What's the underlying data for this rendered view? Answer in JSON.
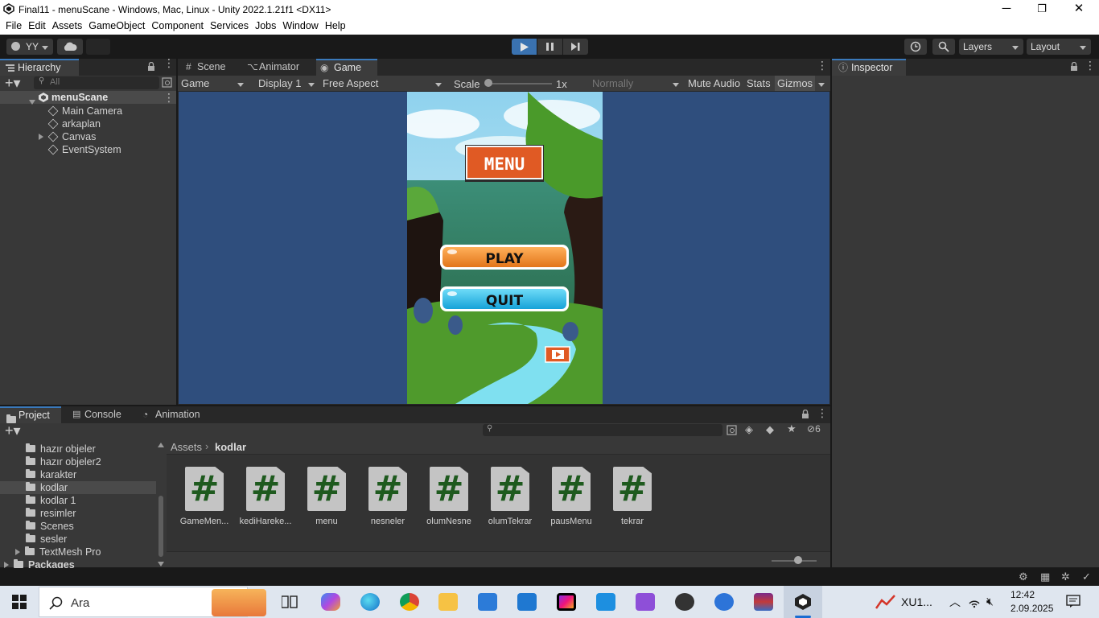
{
  "window": {
    "title": "Final11 - menuScane - Windows, Mac, Linux - Unity 2022.1.21f1 <DX11>",
    "minimize": "─",
    "maximize": "❐",
    "close": "✕"
  },
  "menu": [
    "File",
    "Edit",
    "Assets",
    "GameObject",
    "Component",
    "Services",
    "Jobs",
    "Window",
    "Help"
  ],
  "toolbar": {
    "account": "YY",
    "layers": "Layers",
    "layout": "Layout"
  },
  "hierarchy": {
    "tab": "Hierarchy",
    "search_placeholder": "All",
    "scene": "menuScane",
    "items": [
      "Main Camera",
      "arkaplan",
      "Canvas",
      "EventSystem"
    ]
  },
  "views": {
    "tabs": [
      "Scene",
      "Animator",
      "Game"
    ],
    "active_tab": "Game",
    "game_dropdown": "Game",
    "display": "Display 1",
    "aspect": "Free Aspect",
    "scale_label": "Scale",
    "scale_value": "1x",
    "quality": "Normally",
    "mute_audio": "Mute Audio",
    "stats": "Stats",
    "gizmos": "Gizmos"
  },
  "game": {
    "menu_title": "MENU",
    "play_button": "PLAY",
    "quit_button": "QUIT"
  },
  "inspector": {
    "tab": "Inspector"
  },
  "project": {
    "tabs": [
      "Project",
      "Console",
      "Animation"
    ],
    "tree": [
      "hazır objeler",
      "hazır objeler2",
      "karakter",
      "kodlar",
      "kodlar 1",
      "resimler",
      "Scenes",
      "sesler",
      "TextMesh Pro"
    ],
    "selected": "kodlar",
    "packages": "Packages",
    "breadcrumb_root": "Assets",
    "breadcrumb_current": "kodlar",
    "hidden_count": "6",
    "scripts": [
      "GameMen...",
      "kediHareke...",
      "menu",
      "nesneler",
      "olumNesne",
      "olumTekrar",
      "pausMenu",
      "tekrar"
    ]
  },
  "taskbar": {
    "search": "Ara",
    "app_label": "XU1...",
    "time": "12:42",
    "date": "2.09.2025"
  },
  "colors": {
    "game_bg": "#2f4e7d",
    "unity_dark": "#191919",
    "panel": "#383838",
    "accent": "#3a79bb",
    "play_btn": "#f08a2c",
    "quit_btn": "#2ab4e8",
    "menu_sign": "#e05a24"
  }
}
